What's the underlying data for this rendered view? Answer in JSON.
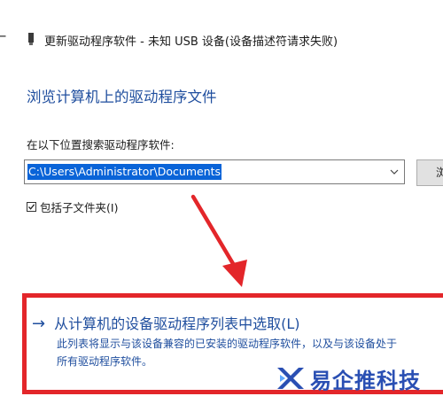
{
  "window": {
    "title": "更新驱动程序软件 - 未知 USB 设备(设备描述符请求失败)"
  },
  "icons": {
    "back": "back-arrow-icon",
    "device": "usb-device-icon",
    "chevron": "chevron-down-icon",
    "check": "checkmark-icon",
    "link_arrow": "right-arrow-icon"
  },
  "heading": "浏览计算机上的驱动程序文件",
  "search": {
    "label": "在以下位置搜索驱动程序软件:",
    "path_value": "C:\\Users\\Administrator\\Documents",
    "browse_label": "浏"
  },
  "include_subfolders": {
    "label": "包括子文件夹(I)",
    "checked": true
  },
  "pick_from_list": {
    "arrow": "→",
    "label": "从计算机的设备驱动程序列表中选取(L)",
    "description_line1": "此列表将显示与该设备兼容的已安装的驱动程序软件，以及与该设备处于",
    "description_line2": "所有驱动程序软件。"
  },
  "watermark": {
    "text": "易企推科技"
  },
  "colors": {
    "accent_blue": "#1f4e9e",
    "selection_blue": "#0a64d8",
    "annotation_red": "#e3262a",
    "watermark_blue": "#2a4fb3"
  }
}
